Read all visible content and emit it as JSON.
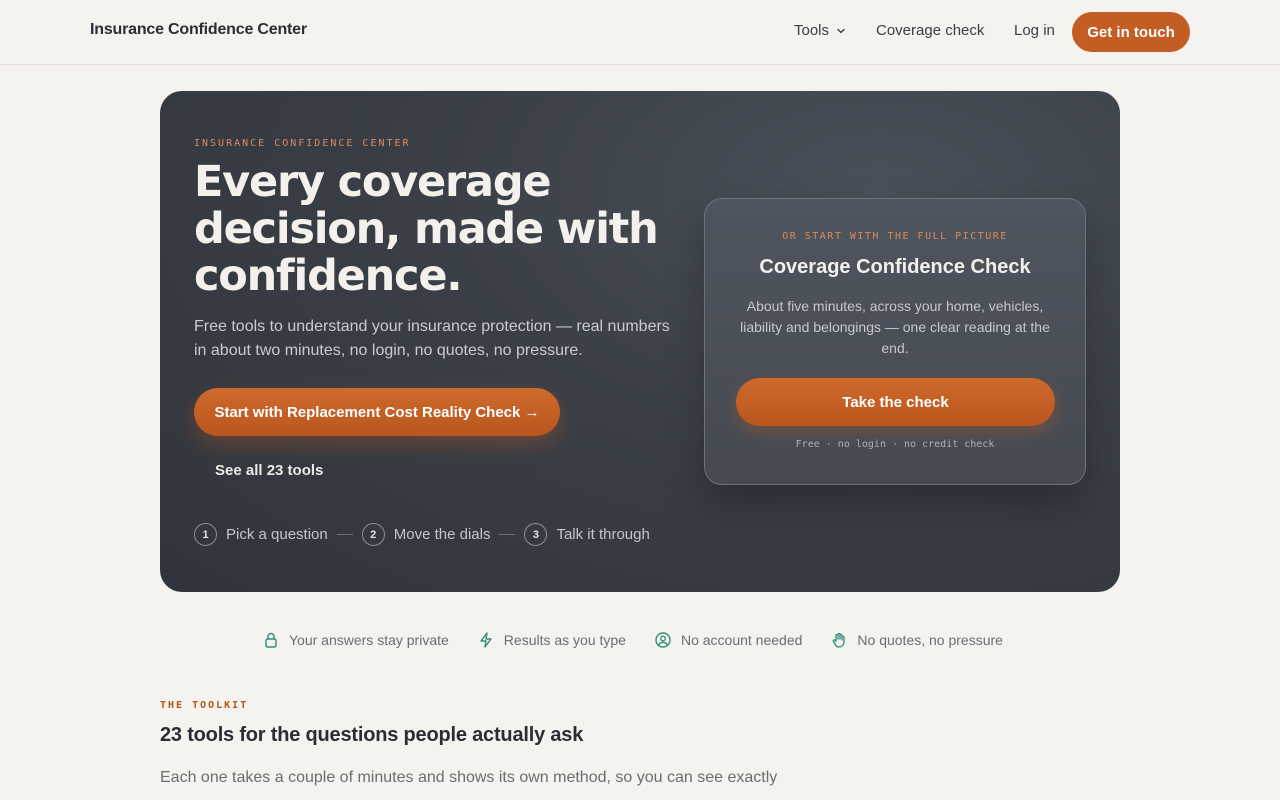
{
  "header": {
    "brand": "Insurance Confidence Center",
    "nav": {
      "tools": "Tools",
      "coverage_check": "Coverage check",
      "login": "Log in",
      "cta": "Get in touch"
    }
  },
  "hero": {
    "eyebrow": "INSURANCE CONFIDENCE CENTER",
    "title": "Every coverage decision, made with confidence.",
    "subtitle": "Free tools to understand your insurance protection — real numbers in about two minutes, no login, no quotes, no pressure.",
    "primary_cta": "Start with Replacement Cost Reality Check →",
    "secondary_link": "See all 23 tools",
    "steps": [
      {
        "num": "1",
        "label": "Pick a question"
      },
      {
        "num": "2",
        "label": "Move the dials"
      },
      {
        "num": "3",
        "label": "Talk it through"
      }
    ]
  },
  "check_card": {
    "eyebrow": "OR START WITH THE FULL PICTURE",
    "title": "Coverage Confidence Check",
    "description": "About five minutes, across your home, vehicles, liability and belongings — one clear reading at the end.",
    "cta": "Take the check",
    "note": "Free · no login · no credit check"
  },
  "trust": [
    {
      "icon": "lock-icon",
      "label": "Your answers stay private"
    },
    {
      "icon": "lightning-icon",
      "label": "Results as you type"
    },
    {
      "icon": "user-circle-icon",
      "label": "No account needed"
    },
    {
      "icon": "hand-icon",
      "label": "No quotes, no pressure"
    }
  ],
  "toolkit": {
    "eyebrow": "THE TOOLKIT",
    "title": "23 tools for the questions people actually ask",
    "description": "Each one takes a couple of minutes and shows its own method, so you can see exactly"
  },
  "colors": {
    "accent": "#c45d24",
    "hero_bg": "#3a3f47",
    "page_bg": "#f5f3ef",
    "trust_icon": "#2f8f7a"
  }
}
